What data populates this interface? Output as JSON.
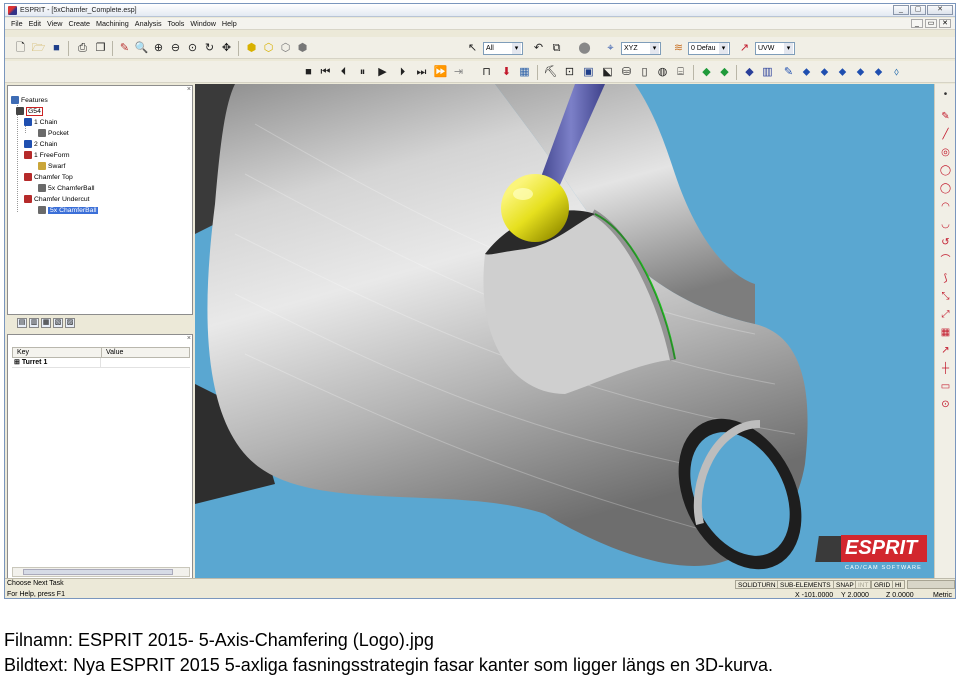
{
  "window": {
    "title": "ESPRIT - [5xChamfer_Complete.esp]",
    "btn_min": "_",
    "btn_max": "▢",
    "btn_close": "✕"
  },
  "menu": [
    "File",
    "Edit",
    "View",
    "Create",
    "Machining",
    "Analysis",
    "Tools",
    "Window",
    "Help"
  ],
  "mdi_buttons": [
    "_",
    "▭",
    "✕"
  ],
  "toolbar": {
    "filter_select": "All",
    "plane_select": "XYZ",
    "layer_select": "0 Defau",
    "workplane_select": "UVW"
  },
  "feature_tree": {
    "root": "Features",
    "items": [
      {
        "label": "G54"
      },
      {
        "label": "1 Chain"
      },
      {
        "label": "Pocket"
      },
      {
        "label": "2 Chain"
      },
      {
        "label": "1 FreeForm"
      },
      {
        "label": "Swarf"
      },
      {
        "label": "Chamfer Top"
      },
      {
        "label": "5x ChamferBall"
      },
      {
        "label": "Chamfer Undercut"
      },
      {
        "label": "5x ChamferBall"
      }
    ]
  },
  "properties": {
    "col_key": "Key",
    "col_value": "Value",
    "rows": [
      {
        "key": "Turret 1",
        "value": ""
      }
    ]
  },
  "logo": {
    "name": "ESPRIT",
    "tagline": "CAD/CAM SOFTWARE"
  },
  "status": {
    "line1": "Choose Next Task",
    "line2": "For Help, press F1",
    "modes": [
      "SOLIDTURN",
      "SUB-ELEMENTS",
      "SNAP",
      "INT",
      "GRID",
      "HI"
    ],
    "x": "X -101.0000",
    "y": "Y 2.0000",
    "z": "Z 0.0000",
    "units": "Metric"
  },
  "captions": {
    "filename": "Filnamn: ESPRIT 2015- 5-Axis-Chamfering (Logo).jpg",
    "text": "Bildtext: Nya ESPRIT 2015 5-axliga fasningsstrategin fasar kanter som ligger längs en 3D-kurva."
  },
  "colors": {
    "viewport_bg": "#5aa7d1",
    "tool_ball": "#e6e01e",
    "tool_shank": "#5b5fa8",
    "toolpath": "#1fbf1f",
    "logo_red": "#d2272e"
  }
}
